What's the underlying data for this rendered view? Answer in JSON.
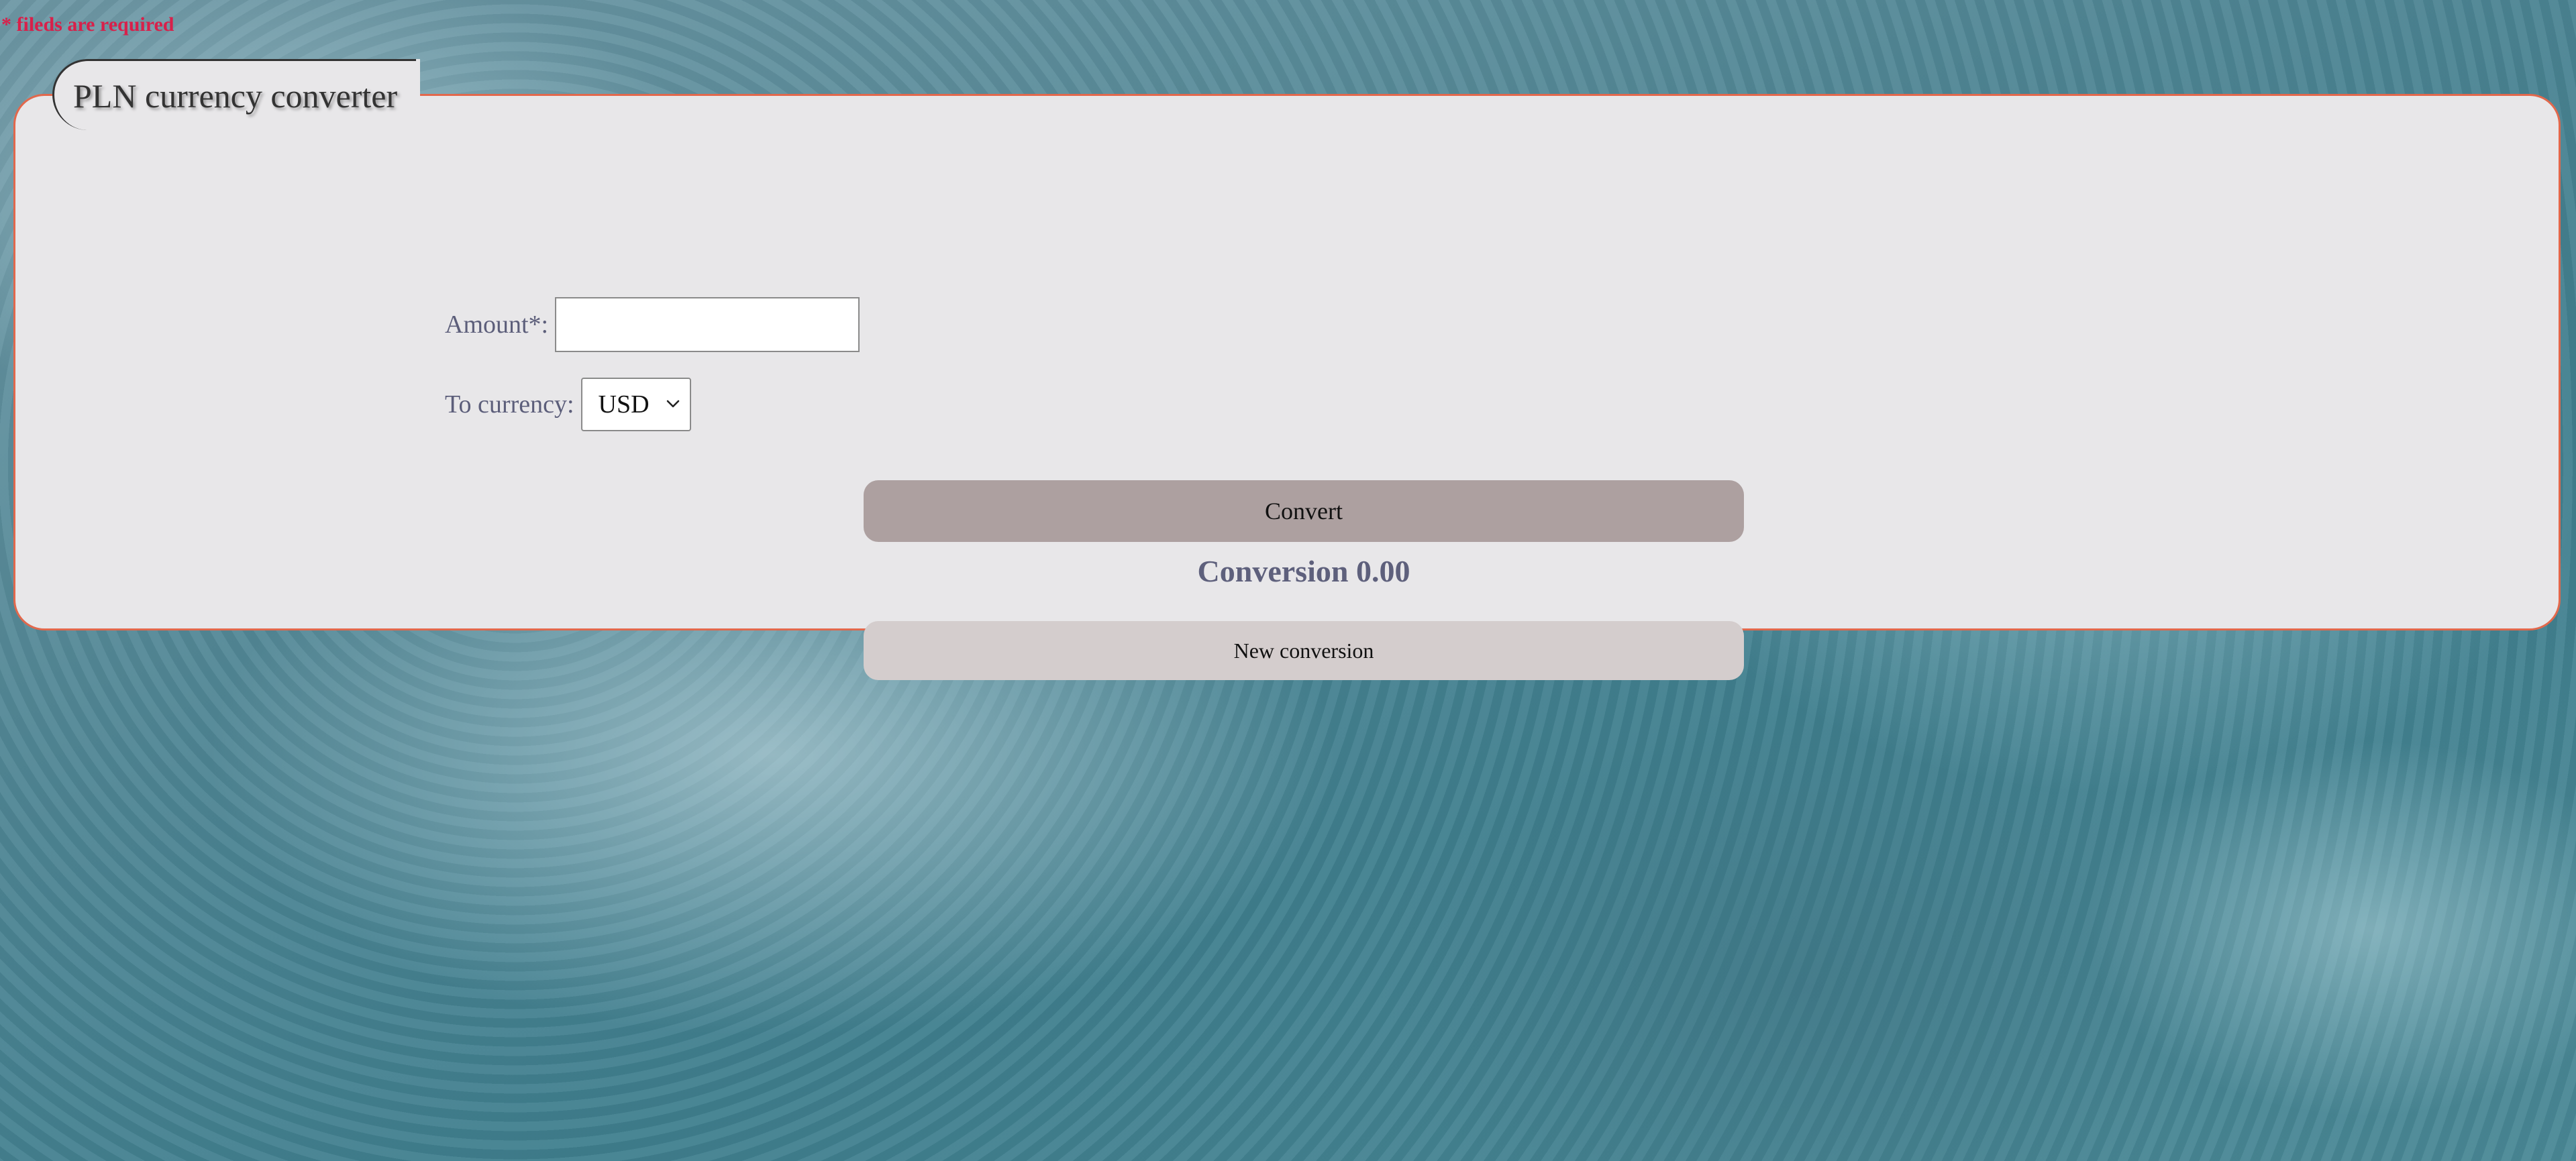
{
  "required_note": "* fileds are required",
  "form": {
    "legend": "PLN currency converter",
    "amount": {
      "label": "Amount*:",
      "value": "",
      "placeholder": ""
    },
    "currency": {
      "label": "To currency:",
      "selected": "USD"
    },
    "convert_label": "Convert",
    "result": {
      "label": "Conversion",
      "value": "0.00"
    },
    "new_conversion_label": "New conversion"
  },
  "colors": {
    "required_note": "#d8204a",
    "panel_background": "#e8e7e9",
    "panel_border": "#e2684c",
    "convert_button": "#ada0a0",
    "new_conversion_button": "#d4cdcd",
    "label_text": "#5c5e7a"
  },
  "icons": {
    "currency_dropdown": "chevron-down-icon"
  }
}
